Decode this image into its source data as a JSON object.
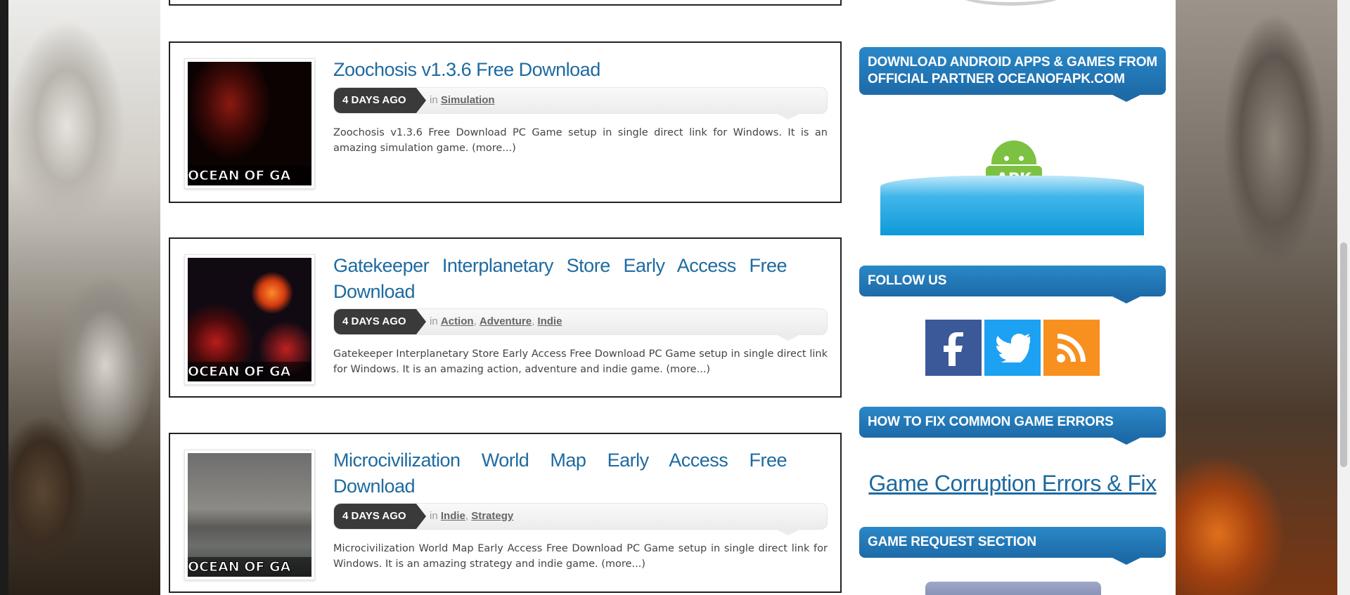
{
  "posts": [
    {
      "title": "Zoochosis v1.3.6 Free Download",
      "date": "4 DAYS AGO",
      "in_label": "in",
      "categories": [
        "Simulation"
      ],
      "excerpt": "Zoochosis v1.3.6 Free Download PC Game setup in single direct link for Windows. It is an amazing simulation game.",
      "more": "(more...)",
      "thumb_watermark": "OCEAN OF GA"
    },
    {
      "title": "Gatekeeper Interplanetary Store Early Access Free Download",
      "date": "4 DAYS AGO",
      "in_label": "in",
      "categories": [
        "Action",
        "Adventure",
        "Indie"
      ],
      "excerpt": "Gatekeeper Interplanetary Store Early Access Free Download PC Game setup in single direct link for Windows. It is an amazing action, adventure and indie game.",
      "more": "(more...)",
      "thumb_watermark": "OCEAN OF GA"
    },
    {
      "title": "Microcivilization World Map Early Access Free Download",
      "date": "4 DAYS AGO",
      "in_label": "in",
      "categories": [
        "Indie",
        "Strategy"
      ],
      "excerpt": "Microcivilization World Map Early Access Free Download PC Game setup in single direct link for Windows. It is an amazing strategy and indie game.",
      "more": "(more...)",
      "thumb_watermark": "OCEAN OF GA"
    }
  ],
  "sidebar": {
    "android_heading": "DOWNLOAD ANDROID APPS & GAMES FROM OFFICIAL PARTNER OCEANOFAPK.COM",
    "apk_logo_text": "APK",
    "follow_heading": "FOLLOW US",
    "social": [
      "facebook-icon",
      "twitter-icon",
      "rss-icon"
    ],
    "errors_heading": "HOW TO FIX COMMON GAME ERRORS",
    "errors_link": "Game Corruption Errors & Fix",
    "request_heading": "GAME REQUEST SECTION"
  },
  "colors": {
    "link_blue": "#1e6aa0",
    "widget_blue": "#1d6aa7",
    "facebook": "#3b5998",
    "twitter": "#1da1f2",
    "rss": "#f7901e"
  }
}
